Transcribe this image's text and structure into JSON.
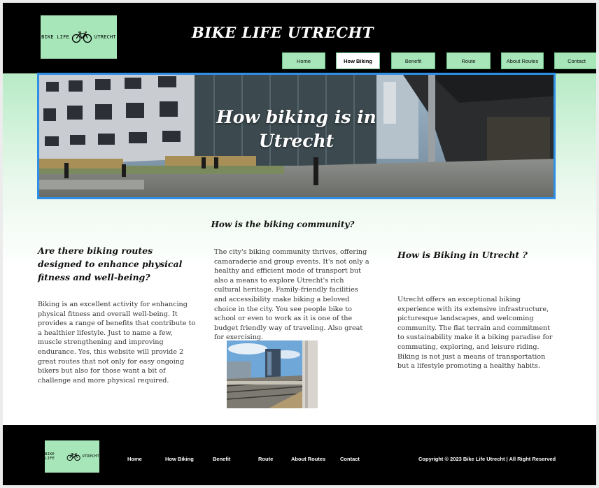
{
  "header": {
    "logo_left": "BIKE LIFE",
    "logo_right": "UTRECHT",
    "title": "BIKE LIFE UTRECHT"
  },
  "nav": {
    "items": [
      {
        "label": "Home",
        "active": false
      },
      {
        "label": "How Biking",
        "active": true
      },
      {
        "label": "Benefit",
        "active": false
      },
      {
        "label": "Route",
        "active": false
      },
      {
        "label": "About Routes",
        "active": false
      },
      {
        "label": "Contact",
        "active": false
      }
    ]
  },
  "hero": {
    "title_line1": "How biking is in",
    "title_line2": "Utrecht"
  },
  "content": {
    "middle_heading": "How is the biking community?",
    "left": {
      "heading": "Are there biking routes designed to enhance physical fitness and well-being?",
      "text": "Biking is an excellent activity for enhancing physical fitness and overall well-being. It provides a range of benefits that contribute to a healthier lifestyle. Just to name a few, muscle strengthening and improving endurance. Yes, this website will provide 2 great routes that not only for easy ongoing bikers but also for those want a bit of challenge and more physical required."
    },
    "middle": {
      "text": "The city's biking community thrives, offering camaraderie and group events. It's not only a healthy and efficient mode of transport but also a means to explore Utrecht's rich cultural heritage. Family-friendly facilities and accessibility make biking a beloved choice in the city. You see people bike to school or even to work as it is one of the budget friendly way of traveling. Also great for exercising."
    },
    "right": {
      "heading": "How is Biking in Utrecht ?",
      "text": "Utrecht offers an exceptional biking experience with its extensive infrastructure, picturesque landscapes, and welcoming community. The flat terrain and commitment to sustainability make it a biking paradise for commuting, exploring, and leisure riding. Biking is not just a means of transportation but a lifestyle promoting a healthy habits."
    }
  },
  "footer": {
    "logo_left": "BIKE LIFE",
    "logo_right": "UTRECHT",
    "links": [
      "Home",
      "How Biking",
      "Benefit",
      "Route",
      "About Routes",
      "Contact"
    ],
    "copyright": "Copyright  © 2023 Bike Life Utrecht | All Right Reserved"
  },
  "colors": {
    "accent_green": "#a6e6b8",
    "hero_border": "#2f8fe6",
    "header_bg": "#000000"
  },
  "icons": {
    "logo": "bicycle-icon"
  }
}
